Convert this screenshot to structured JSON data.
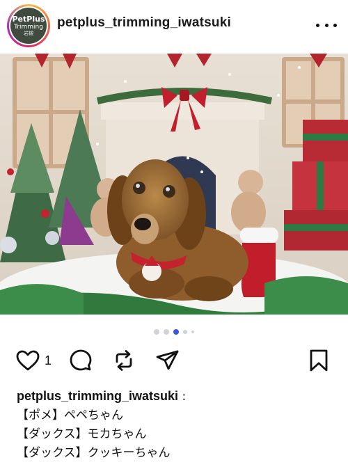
{
  "post": {
    "username": "petplus_trimming_iwatsuki",
    "avatar": {
      "line1": "PetPlus",
      "line2": "Trimming",
      "line3": "岩槻"
    },
    "like_count": "1",
    "carousel": {
      "total": 5,
      "active_index": 2
    }
  },
  "caption": {
    "owner": "petplus_trimming_iwatsuki",
    "separator": " :",
    "lines": [
      "【ポメ】ペペちゃん",
      "【ダックス】モカちゃん",
      "【ダックス】クッキーちゃん"
    ]
  },
  "icons": {
    "more": "more-horizontal-icon",
    "like": "heart-icon",
    "comment": "comment-icon",
    "repost": "repost-icon",
    "share": "send-icon",
    "save": "bookmark-icon"
  },
  "colors": {
    "text": "#111111",
    "carousel_active": "#3b5bd8",
    "carousel_inactive": "#cfd3d8"
  }
}
